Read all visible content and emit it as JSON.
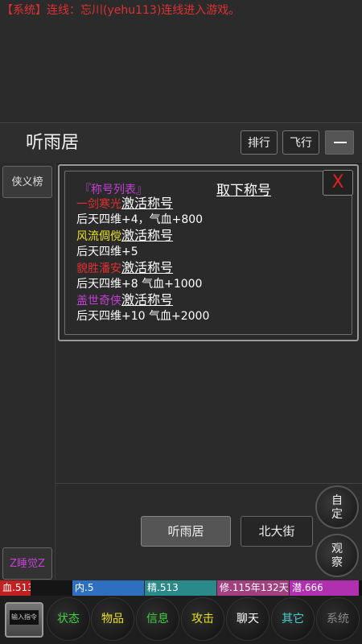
{
  "system_message": "【系统】连线：忘川(yehu113)连线进入游戏。",
  "header": {
    "location": "听雨居",
    "rank_button": "排行",
    "fly_button": "飞行"
  },
  "sidebar": {
    "heroes_button": "侠义榜",
    "sleep_button": "Z睡觉Z"
  },
  "panel": {
    "list_title": "『称号列表』",
    "remove_title": "取下称号",
    "close": "X",
    "titles": [
      {
        "name": "一剑寒光",
        "color": "#e03030",
        "action": "激活称号",
        "bonus": "后天四维+4，气血+800"
      },
      {
        "name": "风流倜傥",
        "color": "#e8e020",
        "action": "激活称号",
        "bonus": "后天四维+5"
      },
      {
        "name": "貌胜潘安",
        "color": "#e03030",
        "action": "激活称号",
        "bonus": "后天四维+8 气血+1000"
      },
      {
        "name": "盖世奇侠",
        "color": "#c040d0",
        "action": "激活称号",
        "bonus": "后天四维+10 气血+2000"
      }
    ]
  },
  "bottom": {
    "current_location": "听雨居",
    "exit_north": "北大街",
    "custom": [
      "自",
      "定"
    ],
    "observe": [
      "观",
      "察"
    ]
  },
  "stats": {
    "hp": "血.513",
    "internal": "内.5",
    "spirit": "精.513",
    "cultivation": "修.115年132天",
    "potential": "潜.666",
    "colors": {
      "hp": "#c02020",
      "internal": "#2f6fc0",
      "spirit": "#2a8a8a",
      "cultivation": "#a04080",
      "potential": "#b030b0"
    }
  },
  "menu": {
    "input_command": "输入指令",
    "items": [
      {
        "label": "状态",
        "color": "#40d040"
      },
      {
        "label": "物品",
        "color": "#e8e020"
      },
      {
        "label": "信息",
        "color": "#40d040"
      },
      {
        "label": "攻击",
        "color": "#e8e020"
      },
      {
        "label": "聊天",
        "color": "#ffffff"
      },
      {
        "label": "其它",
        "color": "#40d0d0"
      }
    ],
    "system": "系统"
  }
}
